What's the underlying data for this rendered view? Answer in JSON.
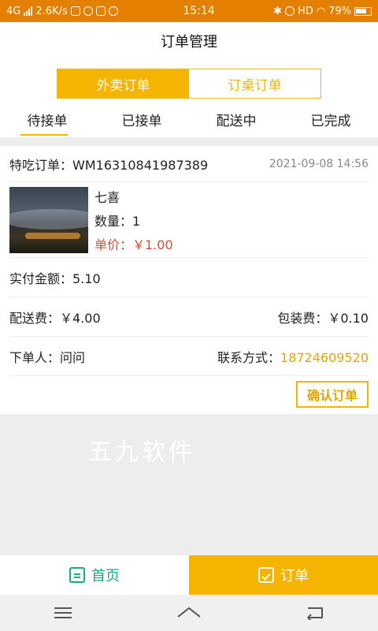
{
  "status_bar": {
    "network": "4G",
    "speed": "2.6K/s",
    "time": "15:14",
    "hd": "HD",
    "battery": "79%"
  },
  "header": {
    "title": "订单管理"
  },
  "segment": {
    "items": [
      "外卖订单",
      "订桌订单"
    ],
    "active": "外卖订单"
  },
  "tabs": {
    "items": [
      "待接单",
      "已接单",
      "配送中",
      "已完成"
    ],
    "active": "待接单"
  },
  "order": {
    "label_prefix": "特吃订单：",
    "order_no": "WM16310841987389",
    "time": "2021-09-08 14:56",
    "product_name": "七喜",
    "quantity_text": "数量：1",
    "unit_price_text": "单价：￥1.00",
    "paid_text": "实付金额：5.10",
    "delivery_fee_text": "配送费：￥4.00",
    "packing_fee_text": "包装费：￥0.10",
    "buyer_text": "下单人：问问",
    "contact_label": "联系方式：",
    "contact_phone": "18724609520",
    "confirm_label": "确认订单"
  },
  "watermark": "五九软件",
  "bottom_nav": {
    "home": "首页",
    "order": "订单"
  },
  "colors": {
    "accent": "#f5b400",
    "status_bar": "#e57f00",
    "price": "#e04a2a",
    "home_green": "#19a98a"
  }
}
